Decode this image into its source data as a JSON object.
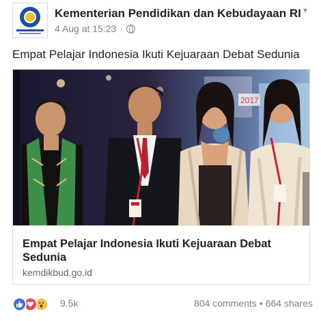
{
  "post": {
    "page_name": "Kementerian Pendidikan dan Kebudayaan RI",
    "timestamp": "4 Aug at 15:23",
    "separator": "·",
    "text": "Empat Pelajar Indonesia Ikuti Kejuaraan Debat Sedunia",
    "privacy_icon": "globe-icon",
    "menu_icon": "chevron-down-icon"
  },
  "link": {
    "title": "Empat Pelajar Indonesia Ikuti Kejuaraan Debat Sedunia",
    "domain": "kemdikbud.go.id",
    "image_backdrop_text": "2017"
  },
  "engagement": {
    "reactions": [
      "like-icon",
      "love-icon",
      "wow-icon"
    ],
    "reaction_count": "9.5k",
    "comments": "804 comments",
    "shares": "664 shares",
    "separator": "•"
  },
  "colors": {
    "like": "#3b6fe0",
    "love": "#e8435a",
    "wow": "#f5c33b",
    "text_primary": "#1d2129",
    "text_secondary": "#7f7f7f"
  }
}
